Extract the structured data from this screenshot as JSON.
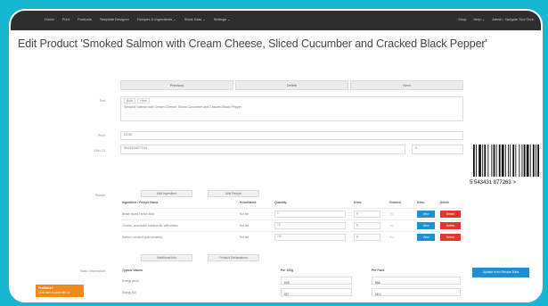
{
  "topbar": {
    "nav": [
      "Home",
      "Print",
      "Products",
      "Template Designer",
      "Recipes & Ingredients ⌄",
      "Stock Data ⌄",
      "Settings ⌄"
    ],
    "right": [
      "Shop",
      "Help ⌄",
      "Admin - Nutgate Tool Tech"
    ]
  },
  "page_title": "Edit Product 'Smoked Salmon with Cream Cheese, Sliced Cucumber and Cracked Black Pepper'",
  "nav_buttons": {
    "previous": "Previous",
    "delete": "Delete",
    "next": "Next"
  },
  "form": {
    "text_label": "Text",
    "editor_tab_bold": "Bold",
    "editor_tab_html": "Html",
    "text_value": "Smoked Salmon with Cream Cheese, Sliced Cucumber and Cracked Black Pepper",
    "price_label": "Price",
    "price_value": "£3.50",
    "ean_label": "EAN 13",
    "ean_value": "5543431877234",
    "ean_extra": "0"
  },
  "barcode_text": "5 543431 877263 >",
  "recipe": {
    "label": "Recipe",
    "add_ingredient": "Add Ingredient",
    "add_recipe": "Add Recipe",
    "headers": [
      "Ingredient / Recipe Name",
      "Price/Name",
      "Quantity",
      "Units",
      "Gramed",
      "Desc.",
      "Delete"
    ],
    "rows": [
      {
        "name": "Brown sliced French stick",
        "price": "Not set",
        "qty": "1",
        "unit": "g",
        "gramed": "Hm"
      },
      {
        "name": "Cheese, processed, medium-fat, with chives",
        "price": "Not set",
        "qty": "15",
        "unit": "g",
        "gramed": "Hm"
      },
      {
        "name": "Salmon, smoked (cold-smoked)",
        "price": "Not set",
        "qty": "150",
        "unit": "g",
        "gramed": "Hm"
      }
    ],
    "view_label": "View",
    "delete_label": "Delete"
  },
  "tabs": {
    "nutritional": "Nutritional Info",
    "product_declarations": "Product Declarations"
  },
  "nutrition": {
    "label": "Basic Information",
    "headers": [
      "Typical Values",
      "Per 100g",
      "Per Pack"
    ],
    "rows": [
      {
        "name": "Energy (kcal)",
        "per100": "177",
        "unit100": "kcal",
        "perpack": "531",
        "unitpack": "kcal"
      },
      {
        "name": "Energy (kJ)",
        "per100": "737",
        "unit100": "kJ",
        "perpack": "2206",
        "unitpack": "kJ"
      }
    ],
    "update_button": "Update from Recipe Data"
  },
  "feedback": {
    "title": "Feedback?",
    "subtitle": "Click here to chat with us"
  }
}
